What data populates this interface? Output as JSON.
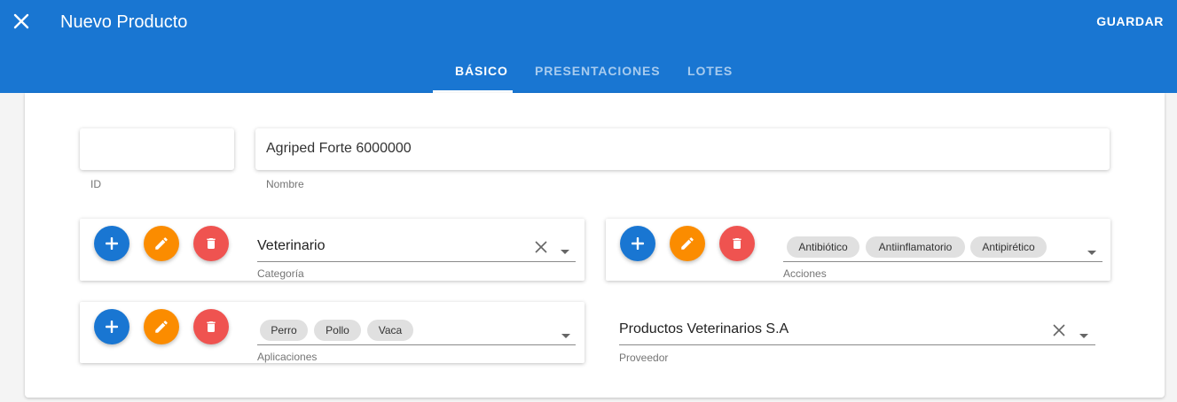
{
  "appbar": {
    "title": "Nuevo Producto",
    "save_label": "GUARDAR",
    "close_icon": "close-icon",
    "tabs": [
      {
        "label": "BÁSICO",
        "active": true
      },
      {
        "label": "PRESENTACIONES",
        "active": false
      },
      {
        "label": "LOTES",
        "active": false
      }
    ]
  },
  "form": {
    "id": {
      "value": "",
      "label": "ID"
    },
    "nombre": {
      "value": "Agriped Forte 6000000",
      "label": "Nombre"
    },
    "categoria": {
      "value": "Veterinario",
      "label": "Categoría"
    },
    "acciones": {
      "chips": [
        "Antibiótico",
        "Antiinflamatorio",
        "Antipirético"
      ],
      "label": "Acciones"
    },
    "aplicaciones": {
      "chips": [
        "Perro",
        "Pollo",
        "Vaca"
      ],
      "label": "Aplicaciones"
    },
    "proveedor": {
      "value": "Productos Veterinarios S.A",
      "label": "Proveedor"
    }
  },
  "colors": {
    "primary": "#1976d2",
    "add": "#1976d2",
    "edit": "#fb8c00",
    "delete": "#ef5350"
  }
}
